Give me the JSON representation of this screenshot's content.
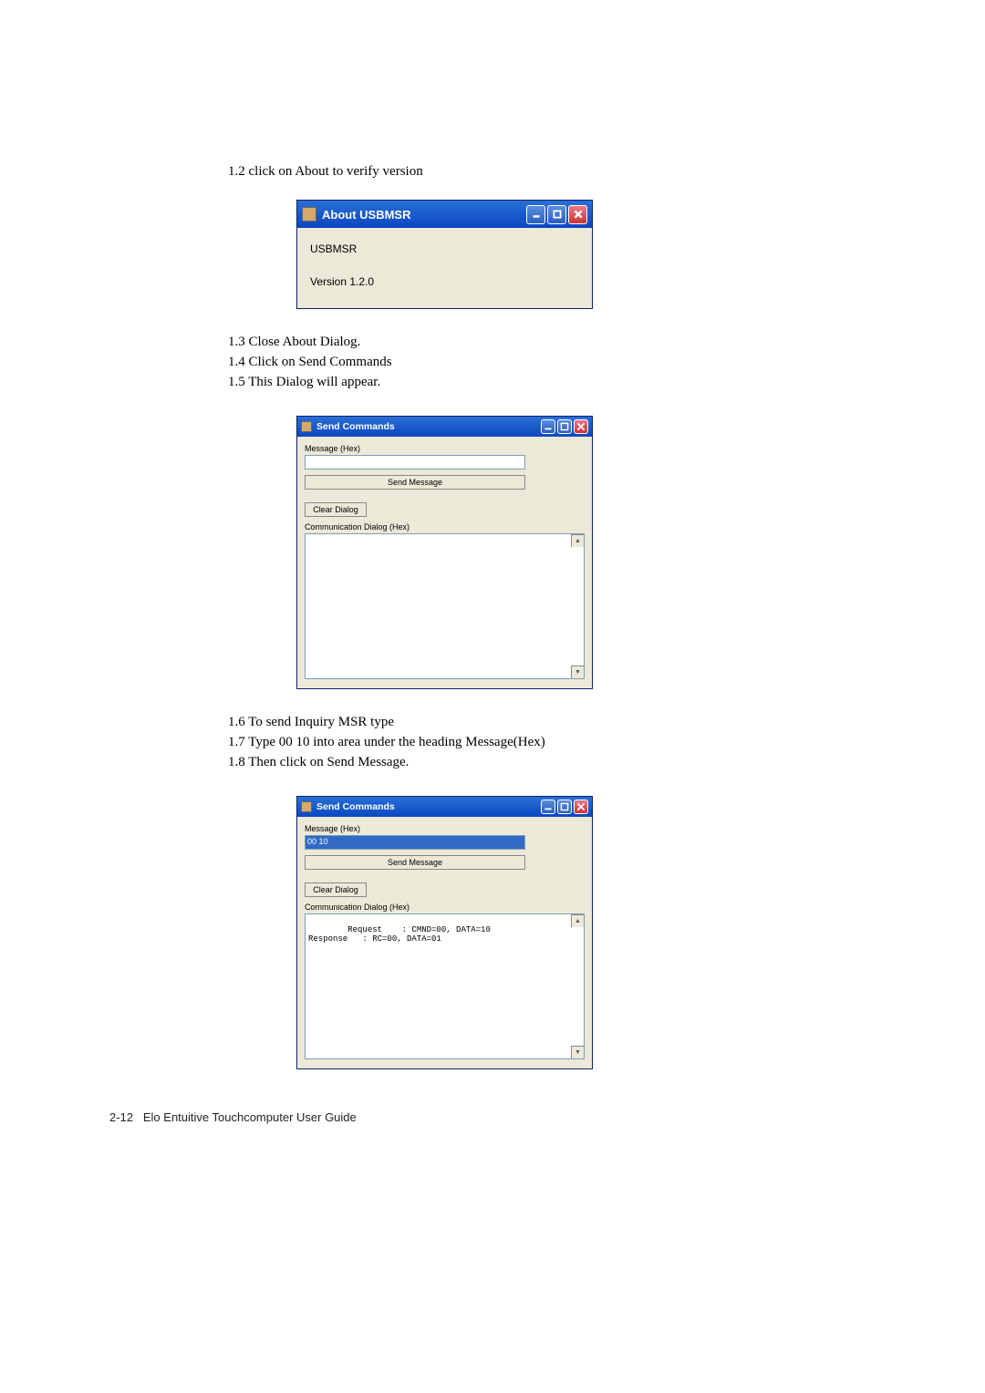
{
  "steps": {
    "s1_2": "1.2 click on About to verify version",
    "s1_3": "1.3 Close About Dialog.",
    "s1_4": "1.4 Click on Send Commands",
    "s1_5": "1.5 This Dialog will appear.",
    "s1_6": "1.6 To send Inquiry MSR type",
    "s1_7": "1.7 Type 00 10 into area under the heading Message(Hex)",
    "s1_8": "1.8 Then click on Send Message."
  },
  "about": {
    "title": "About USBMSR",
    "product": "USBMSR",
    "version": "Version 1.2.0"
  },
  "send1": {
    "title": "Send Commands",
    "msg_label": "Message (Hex)",
    "msg_value": "",
    "send_btn": "Send Message",
    "clear_btn": "Clear Dialog",
    "comm_label": "Communication Dialog (Hex)",
    "comm_content": ""
  },
  "send2": {
    "title": "Send Commands",
    "msg_label": "Message (Hex)",
    "msg_value": "00 10",
    "send_btn": "Send Message",
    "clear_btn": "Clear Dialog",
    "comm_label": "Communication Dialog (Hex)",
    "comm_content": "Request    : CMND=00, DATA=10\nResponse   : RC=00, DATA=01"
  },
  "footer": {
    "page": "2-12",
    "title": "Elo Entuitive Touchcomputer User Guide"
  }
}
